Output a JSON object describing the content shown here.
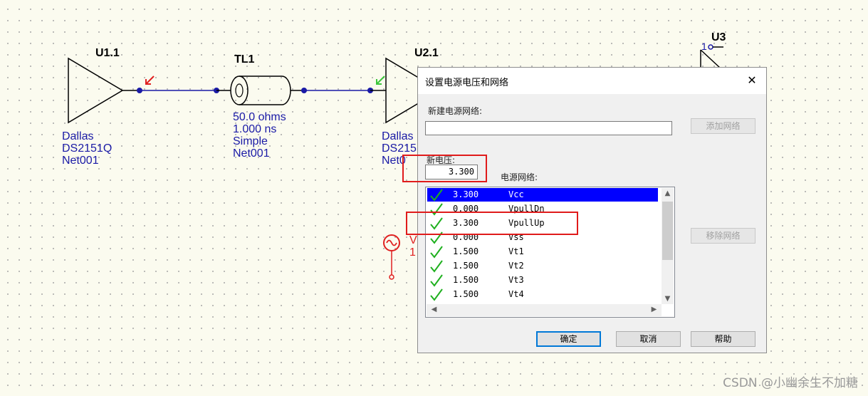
{
  "schematic": {
    "u1": {
      "ref": "U1.1",
      "lines": [
        "Dallas",
        "DS2151Q",
        "Net001"
      ]
    },
    "tl1": {
      "ref": "TL1",
      "lines": [
        "50.0 ohms",
        "1.000 ns",
        "Simple",
        "Net001"
      ]
    },
    "u2": {
      "ref": "U2.1",
      "lines": [
        "Dallas",
        "DS215",
        "Net0"
      ]
    },
    "u3": {
      "ref": "U3",
      "pin": "1"
    },
    "source": {
      "label_line1": "V",
      "label_line2": "1"
    }
  },
  "dialog": {
    "title": "设置电源电压和网络",
    "close_glyph": "✕",
    "new_net_label": "新建电源网络:",
    "new_net_value": "",
    "add_net_button": "添加网络",
    "new_voltage_label": "新电压:",
    "new_voltage_value": "3.300",
    "power_nets_label": "电源网络:",
    "remove_net_button": "移除网络",
    "ok_button": "确定",
    "cancel_button": "取消",
    "help_button": "帮助",
    "nets": [
      {
        "voltage": "3.300",
        "name": "Vcc",
        "selected": true
      },
      {
        "voltage": "0.000",
        "name": "VpullDn",
        "selected": false
      },
      {
        "voltage": "3.300",
        "name": "VpullUp",
        "selected": false
      },
      {
        "voltage": "0.000",
        "name": "Vss",
        "selected": false
      },
      {
        "voltage": "1.500",
        "name": "Vt1",
        "selected": false
      },
      {
        "voltage": "1.500",
        "name": "Vt2",
        "selected": false
      },
      {
        "voltage": "1.500",
        "name": "Vt3",
        "selected": false
      },
      {
        "voltage": "1.500",
        "name": "Vt4",
        "selected": false
      }
    ]
  },
  "colors": {
    "wire": "#1a1aa6",
    "check": "#1fb01f",
    "highlight": "#e01b1b",
    "selection": "#0000ff"
  },
  "watermark": "CSDN @小幽余生不加糖"
}
